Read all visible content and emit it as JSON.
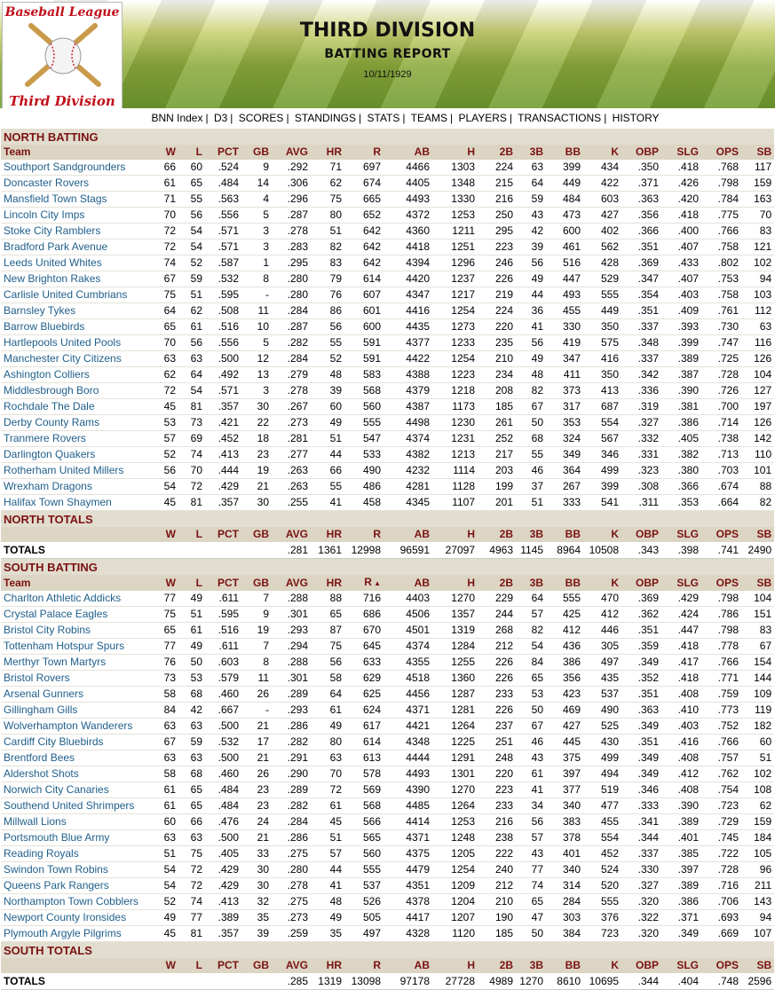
{
  "logo": {
    "line1": "Baseball League",
    "line2": "Third Division"
  },
  "header": {
    "title": "THIRD DIVISION",
    "subtitle": "BATTING REPORT",
    "date": "10/11/1929"
  },
  "nav": [
    "BNN Index",
    "D3",
    "SCORES",
    "STANDINGS",
    "STATS",
    "TEAMS",
    "PLAYERS",
    "TRANSACTIONS",
    "HISTORY"
  ],
  "columns": [
    "Team",
    "W",
    "L",
    "PCT",
    "GB",
    "AVG",
    "HR",
    "R",
    "AB",
    "H",
    "2B",
    "3B",
    "BB",
    "K",
    "OBP",
    "SLG",
    "OPS",
    "SB"
  ],
  "total_columns": [
    "W",
    "L",
    "PCT",
    "GB",
    "AVG",
    "HR",
    "R",
    "AB",
    "H",
    "2B",
    "3B",
    "BB",
    "K",
    "OBP",
    "SLG",
    "OPS",
    "SB"
  ],
  "north": {
    "title": "NORTH BATTING",
    "rows": [
      [
        "Southport Sandgrounders",
        "66",
        "60",
        ".524",
        "9",
        ".292",
        "71",
        "697",
        "4466",
        "1303",
        "224",
        "63",
        "399",
        "434",
        ".350",
        ".418",
        ".768",
        "117"
      ],
      [
        "Doncaster Rovers",
        "61",
        "65",
        ".484",
        "14",
        ".306",
        "62",
        "674",
        "4405",
        "1348",
        "215",
        "64",
        "449",
        "422",
        ".371",
        ".426",
        ".798",
        "159"
      ],
      [
        "Mansfield Town Stags",
        "71",
        "55",
        ".563",
        "4",
        ".296",
        "75",
        "665",
        "4493",
        "1330",
        "216",
        "59",
        "484",
        "603",
        ".363",
        ".420",
        ".784",
        "163"
      ],
      [
        "Lincoln City Imps",
        "70",
        "56",
        ".556",
        "5",
        ".287",
        "80",
        "652",
        "4372",
        "1253",
        "250",
        "43",
        "473",
        "427",
        ".356",
        ".418",
        ".775",
        "70"
      ],
      [
        "Stoke City Ramblers",
        "72",
        "54",
        ".571",
        "3",
        ".278",
        "51",
        "642",
        "4360",
        "1211",
        "295",
        "42",
        "600",
        "402",
        ".366",
        ".400",
        ".766",
        "83"
      ],
      [
        "Bradford Park Avenue",
        "72",
        "54",
        ".571",
        "3",
        ".283",
        "82",
        "642",
        "4418",
        "1251",
        "223",
        "39",
        "461",
        "562",
        ".351",
        ".407",
        ".758",
        "121"
      ],
      [
        "Leeds United Whites",
        "74",
        "52",
        ".587",
        "1",
        ".295",
        "83",
        "642",
        "4394",
        "1296",
        "246",
        "56",
        "516",
        "428",
        ".369",
        ".433",
        ".802",
        "102"
      ],
      [
        "New Brighton Rakes",
        "67",
        "59",
        ".532",
        "8",
        ".280",
        "79",
        "614",
        "4420",
        "1237",
        "226",
        "49",
        "447",
        "529",
        ".347",
        ".407",
        ".753",
        "94"
      ],
      [
        "Carlisle United Cumbrians",
        "75",
        "51",
        ".595",
        "-",
        ".280",
        "76",
        "607",
        "4347",
        "1217",
        "219",
        "44",
        "493",
        "555",
        ".354",
        ".403",
        ".758",
        "103"
      ],
      [
        "Barnsley Tykes",
        "64",
        "62",
        ".508",
        "11",
        ".284",
        "86",
        "601",
        "4416",
        "1254",
        "224",
        "36",
        "455",
        "449",
        ".351",
        ".409",
        ".761",
        "112"
      ],
      [
        "Barrow Bluebirds",
        "65",
        "61",
        ".516",
        "10",
        ".287",
        "56",
        "600",
        "4435",
        "1273",
        "220",
        "41",
        "330",
        "350",
        ".337",
        ".393",
        ".730",
        "63"
      ],
      [
        "Hartlepools United Pools",
        "70",
        "56",
        ".556",
        "5",
        ".282",
        "55",
        "591",
        "4377",
        "1233",
        "235",
        "56",
        "419",
        "575",
        ".348",
        ".399",
        ".747",
        "116"
      ],
      [
        "Manchester City Citizens",
        "63",
        "63",
        ".500",
        "12",
        ".284",
        "52",
        "591",
        "4422",
        "1254",
        "210",
        "49",
        "347",
        "416",
        ".337",
        ".389",
        ".725",
        "126"
      ],
      [
        "Ashington Colliers",
        "62",
        "64",
        ".492",
        "13",
        ".279",
        "48",
        "583",
        "4388",
        "1223",
        "234",
        "48",
        "411",
        "350",
        ".342",
        ".387",
        ".728",
        "104"
      ],
      [
        "Middlesbrough Boro",
        "72",
        "54",
        ".571",
        "3",
        ".278",
        "39",
        "568",
        "4379",
        "1218",
        "208",
        "82",
        "373",
        "413",
        ".336",
        ".390",
        ".726",
        "127"
      ],
      [
        "Rochdale The Dale",
        "45",
        "81",
        ".357",
        "30",
        ".267",
        "60",
        "560",
        "4387",
        "1173",
        "185",
        "67",
        "317",
        "687",
        ".319",
        ".381",
        ".700",
        "197"
      ],
      [
        "Derby County Rams",
        "53",
        "73",
        ".421",
        "22",
        ".273",
        "49",
        "555",
        "4498",
        "1230",
        "261",
        "50",
        "353",
        "554",
        ".327",
        ".386",
        ".714",
        "126"
      ],
      [
        "Tranmere Rovers",
        "57",
        "69",
        ".452",
        "18",
        ".281",
        "51",
        "547",
        "4374",
        "1231",
        "252",
        "68",
        "324",
        "567",
        ".332",
        ".405",
        ".738",
        "142"
      ],
      [
        "Darlington Quakers",
        "52",
        "74",
        ".413",
        "23",
        ".277",
        "44",
        "533",
        "4382",
        "1213",
        "217",
        "55",
        "349",
        "346",
        ".331",
        ".382",
        ".713",
        "110"
      ],
      [
        "Rotherham United Millers",
        "56",
        "70",
        ".444",
        "19",
        ".263",
        "66",
        "490",
        "4232",
        "1114",
        "203",
        "46",
        "364",
        "499",
        ".323",
        ".380",
        ".703",
        "101"
      ],
      [
        "Wrexham Dragons",
        "54",
        "72",
        ".429",
        "21",
        ".263",
        "55",
        "486",
        "4281",
        "1128",
        "199",
        "37",
        "267",
        "399",
        ".308",
        ".366",
        ".674",
        "88"
      ],
      [
        "Halifax Town Shaymen",
        "45",
        "81",
        ".357",
        "30",
        ".255",
        "41",
        "458",
        "4345",
        "1107",
        "201",
        "51",
        "333",
        "541",
        ".311",
        ".353",
        ".664",
        "82"
      ]
    ],
    "totals_title": "NORTH TOTALS",
    "totals_label": "TOTALS",
    "totals": [
      "",
      "",
      "",
      "",
      ".281",
      "1361",
      "12998",
      "96591",
      "27097",
      "4963",
      "1145",
      "8964",
      "10508",
      ".343",
      ".398",
      ".741",
      "2490"
    ]
  },
  "south": {
    "title": "SOUTH BATTING",
    "rows": [
      [
        "Charlton Athletic Addicks",
        "77",
        "49",
        ".611",
        "7",
        ".288",
        "88",
        "716",
        "4403",
        "1270",
        "229",
        "64",
        "555",
        "470",
        ".369",
        ".429",
        ".798",
        "104"
      ],
      [
        "Crystal Palace Eagles",
        "75",
        "51",
        ".595",
        "9",
        ".301",
        "65",
        "686",
        "4506",
        "1357",
        "244",
        "57",
        "425",
        "412",
        ".362",
        ".424",
        ".786",
        "151"
      ],
      [
        "Bristol City Robins",
        "65",
        "61",
        ".516",
        "19",
        ".293",
        "87",
        "670",
        "4501",
        "1319",
        "268",
        "82",
        "412",
        "446",
        ".351",
        ".447",
        ".798",
        "83"
      ],
      [
        "Tottenham Hotspur Spurs",
        "77",
        "49",
        ".611",
        "7",
        ".294",
        "75",
        "645",
        "4374",
        "1284",
        "212",
        "54",
        "436",
        "305",
        ".359",
        ".418",
        ".778",
        "67"
      ],
      [
        "Merthyr Town Martyrs",
        "76",
        "50",
        ".603",
        "8",
        ".288",
        "56",
        "633",
        "4355",
        "1255",
        "226",
        "84",
        "386",
        "497",
        ".349",
        ".417",
        ".766",
        "154"
      ],
      [
        "Bristol Rovers",
        "73",
        "53",
        ".579",
        "11",
        ".301",
        "58",
        "629",
        "4518",
        "1360",
        "226",
        "65",
        "356",
        "435",
        ".352",
        ".418",
        ".771",
        "144"
      ],
      [
        "Arsenal Gunners",
        "58",
        "68",
        ".460",
        "26",
        ".289",
        "64",
        "625",
        "4456",
        "1287",
        "233",
        "53",
        "423",
        "537",
        ".351",
        ".408",
        ".759",
        "109"
      ],
      [
        "Gillingham Gills",
        "84",
        "42",
        ".667",
        "-",
        ".293",
        "61",
        "624",
        "4371",
        "1281",
        "226",
        "50",
        "469",
        "490",
        ".363",
        ".410",
        ".773",
        "119"
      ],
      [
        "Wolverhampton Wanderers",
        "63",
        "63",
        ".500",
        "21",
        ".286",
        "49",
        "617",
        "4421",
        "1264",
        "237",
        "67",
        "427",
        "525",
        ".349",
        ".403",
        ".752",
        "182"
      ],
      [
        "Cardiff City Bluebirds",
        "67",
        "59",
        ".532",
        "17",
        ".282",
        "80",
        "614",
        "4348",
        "1225",
        "251",
        "46",
        "445",
        "430",
        ".351",
        ".416",
        ".766",
        "60"
      ],
      [
        "Brentford Bees",
        "63",
        "63",
        ".500",
        "21",
        ".291",
        "63",
        "613",
        "4444",
        "1291",
        "248",
        "43",
        "375",
        "499",
        ".349",
        ".408",
        ".757",
        "51"
      ],
      [
        "Aldershot Shots",
        "58",
        "68",
        ".460",
        "26",
        ".290",
        "70",
        "578",
        "4493",
        "1301",
        "220",
        "61",
        "397",
        "494",
        ".349",
        ".412",
        ".762",
        "102"
      ],
      [
        "Norwich City Canaries",
        "61",
        "65",
        ".484",
        "23",
        ".289",
        "72",
        "569",
        "4390",
        "1270",
        "223",
        "41",
        "377",
        "519",
        ".346",
        ".408",
        ".754",
        "108"
      ],
      [
        "Southend United Shrimpers",
        "61",
        "65",
        ".484",
        "23",
        ".282",
        "61",
        "568",
        "4485",
        "1264",
        "233",
        "34",
        "340",
        "477",
        ".333",
        ".390",
        ".723",
        "62"
      ],
      [
        "Millwall Lions",
        "60",
        "66",
        ".476",
        "24",
        ".284",
        "45",
        "566",
        "4414",
        "1253",
        "216",
        "56",
        "383",
        "455",
        ".341",
        ".389",
        ".729",
        "159"
      ],
      [
        "Portsmouth Blue Army",
        "63",
        "63",
        ".500",
        "21",
        ".286",
        "51",
        "565",
        "4371",
        "1248",
        "238",
        "57",
        "378",
        "554",
        ".344",
        ".401",
        ".745",
        "184"
      ],
      [
        "Reading Royals",
        "51",
        "75",
        ".405",
        "33",
        ".275",
        "57",
        "560",
        "4375",
        "1205",
        "222",
        "43",
        "401",
        "452",
        ".337",
        ".385",
        ".722",
        "105"
      ],
      [
        "Swindon Town Robins",
        "54",
        "72",
        ".429",
        "30",
        ".280",
        "44",
        "555",
        "4479",
        "1254",
        "240",
        "77",
        "340",
        "524",
        ".330",
        ".397",
        ".728",
        "96"
      ],
      [
        "Queens Park Rangers",
        "54",
        "72",
        ".429",
        "30",
        ".278",
        "41",
        "537",
        "4351",
        "1209",
        "212",
        "74",
        "314",
        "520",
        ".327",
        ".389",
        ".716",
        "211"
      ],
      [
        "Northampton Town Cobblers",
        "52",
        "74",
        ".413",
        "32",
        ".275",
        "48",
        "526",
        "4378",
        "1204",
        "210",
        "65",
        "284",
        "555",
        ".320",
        ".386",
        ".706",
        "143"
      ],
      [
        "Newport County Ironsides",
        "49",
        "77",
        ".389",
        "35",
        ".273",
        "49",
        "505",
        "4417",
        "1207",
        "190",
        "47",
        "303",
        "376",
        ".322",
        ".371",
        ".693",
        "94"
      ],
      [
        "Plymouth Argyle Pilgrims",
        "45",
        "81",
        ".357",
        "39",
        ".259",
        "35",
        "497",
        "4328",
        "1120",
        "185",
        "50",
        "384",
        "723",
        ".320",
        ".349",
        ".669",
        "107"
      ]
    ],
    "totals_title": "SOUTH TOTALS",
    "totals_label": "TOTALS",
    "totals": [
      "",
      "",
      "",
      "",
      ".285",
      "1319",
      "13098",
      "97178",
      "27728",
      "4989",
      "1270",
      "8610",
      "10695",
      ".344",
      ".404",
      ".748",
      "2596"
    ]
  }
}
